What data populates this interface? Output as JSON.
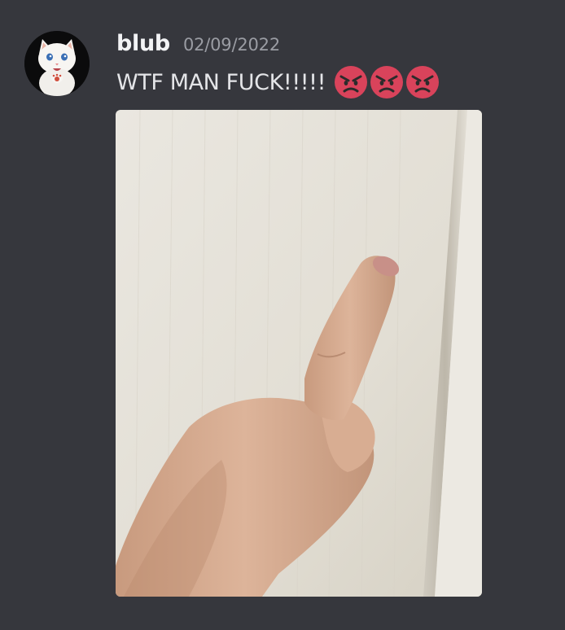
{
  "message": {
    "username": "blub",
    "timestamp": "02/09/2022",
    "text": "WTF MAN FUCK!!!!!",
    "emojis": [
      "angry-face-icon",
      "angry-face-icon",
      "angry-face-icon"
    ],
    "avatar_icon": "white-kitten-avatar",
    "attachment_icon": "middle-finger-photo"
  },
  "colors": {
    "background": "#36373d",
    "username": "#f2f3f5",
    "timestamp": "#9a9ca3",
    "text": "#e4e5e8",
    "emoji_red": "#d9435b"
  }
}
